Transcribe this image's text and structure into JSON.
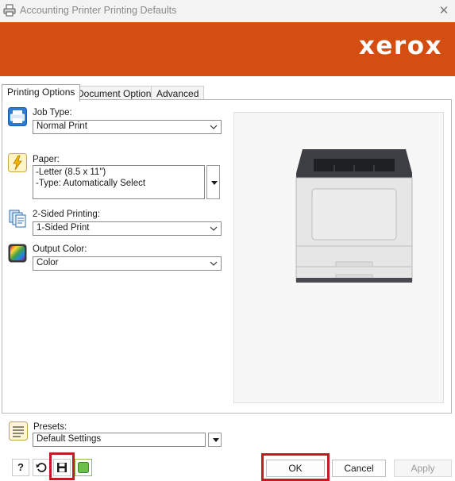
{
  "window": {
    "title": "Accounting Printer Printing Defaults",
    "close_glyph": "✕"
  },
  "banner": {
    "brand": "xerox",
    "color": "#d44e12"
  },
  "tabs": [
    {
      "label": "Printing Options",
      "active": true
    },
    {
      "label": "Document Options",
      "active": false
    },
    {
      "label": "Advanced",
      "active": false
    }
  ],
  "job_type": {
    "label": "Job Type:",
    "value": "Normal Print"
  },
  "paper": {
    "label": "Paper:",
    "lines": [
      "-Letter (8.5 x 11\")",
      "-Type: Automatically Select"
    ]
  },
  "two_sided": {
    "label": "2-Sided Printing:",
    "value": "1-Sided Print"
  },
  "output_color": {
    "label": "Output Color:",
    "value": "Color"
  },
  "presets": {
    "label": "Presets:",
    "value": "Default Settings"
  },
  "bottom_icons": {
    "help": "?"
  },
  "buttons": {
    "ok": "OK",
    "cancel": "Cancel",
    "apply": "Apply"
  },
  "colors": {
    "highlight": "#c21b21",
    "icon_blue": "#2f7bd0"
  }
}
